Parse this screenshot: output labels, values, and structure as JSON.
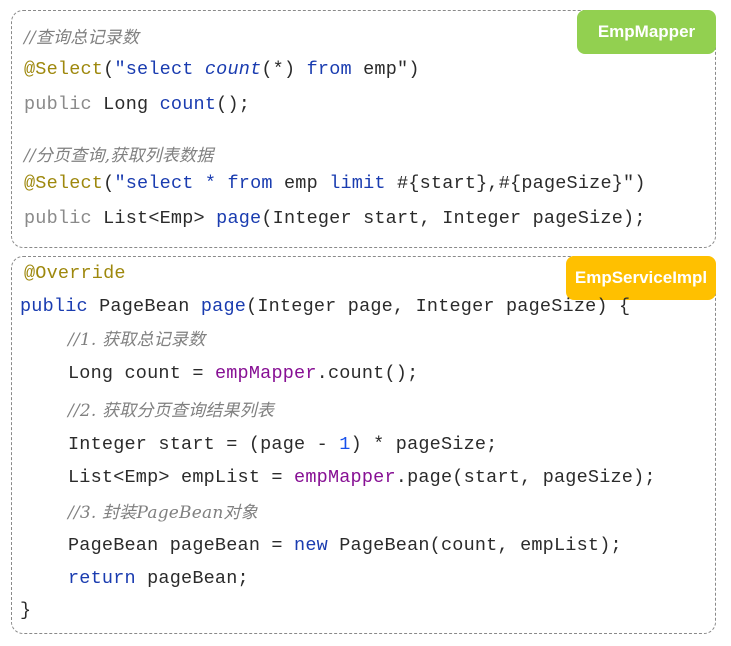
{
  "mapper_panel": {
    "badge": "EmpMapper",
    "line1_comment": "//查询总记录数",
    "line2": {
      "annotation": "@Select",
      "open": "(",
      "str_a": "\"select ",
      "str_fn": "count",
      "str_b": "(*) ",
      "str_from": "from",
      "str_c": " emp\"",
      "close": ")"
    },
    "line3": {
      "kw": "public",
      "type": " Long ",
      "fn": "count",
      "rest": "();"
    },
    "line4_comment": "//分页查询,获取列表数据",
    "line5": {
      "annotation": "@Select",
      "open": "(",
      "str_a": "\"select * ",
      "str_from": "from",
      "str_b": " emp ",
      "str_limit": "limit",
      "str_c": " #{start},#{pageSize}\"",
      "close": ")"
    },
    "line6": {
      "kw": "public",
      "type": " List<Emp> ",
      "fn": "page",
      "rest": "(Integer start, Integer pageSize);"
    }
  },
  "service_panel": {
    "badge": "EmpServiceImpl",
    "line1_annotation": "@Override",
    "line2": {
      "kw": "public",
      "type": " PageBean ",
      "fn": "page",
      "rest": "(Integer page, Integer pageSize) {"
    },
    "line3_comment": "//1. 获取总记录数",
    "line4": {
      "pre": "Long count = ",
      "field": "empMapper",
      "rest": ".count();"
    },
    "line5_comment": "//2. 获取分页查询结果列表",
    "line6": {
      "pre": "Integer start = (page - ",
      "num": "1",
      "rest": ") * pageSize;"
    },
    "line7": {
      "pre": "List<Emp> empList = ",
      "field": "empMapper",
      "rest": ".page(start, pageSize);"
    },
    "line8_comment": "//3. 封装PageBean对象",
    "line9": {
      "pre": "PageBean pageBean = ",
      "kw": "new",
      "rest": " PageBean(count, empList);"
    },
    "line10": {
      "kw": "return",
      "rest": " pageBean;"
    },
    "line11": "}"
  }
}
